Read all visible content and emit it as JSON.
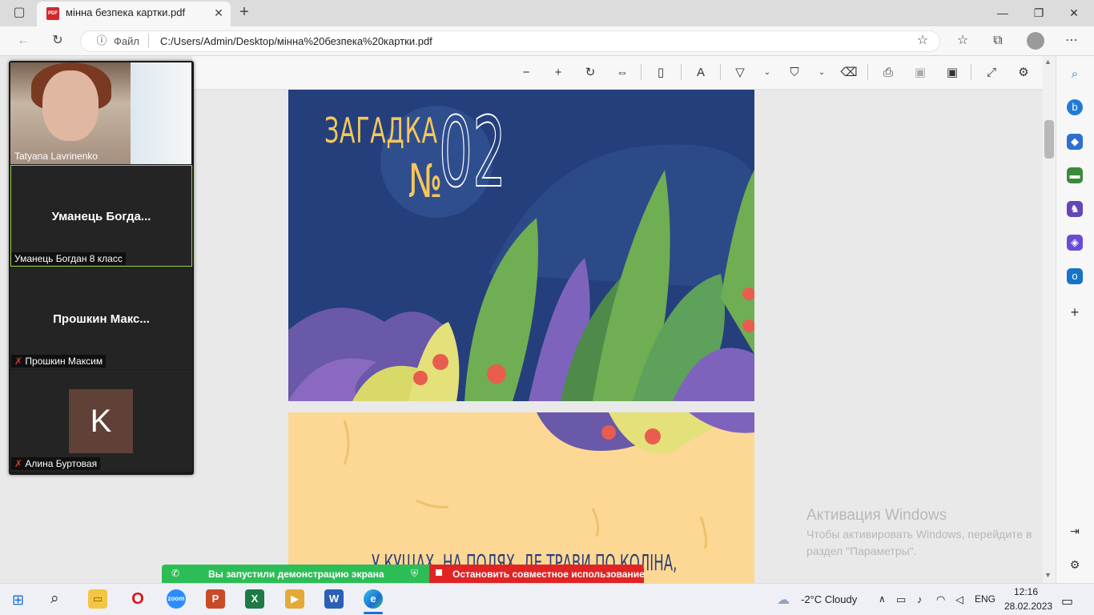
{
  "browser": {
    "tab_title": "мінна безпека картки.pdf",
    "tab_icon_text": "PDF",
    "address_label": "Файл",
    "url": "C:/Users/Admin/Desktop/мінна%20безпека%20картки.pdf"
  },
  "pdf": {
    "page1": {
      "word": "ЗАГАДКА",
      "no": "№",
      "number": "02"
    },
    "page2": {
      "text": "У КУЩАХ, НА ПОЛЯХ, ДЕ ТРАВИ ПО КОЛІНА,"
    }
  },
  "zoom": {
    "participants": [
      {
        "name": "Tatyana Lavrinenko",
        "video": true
      },
      {
        "name": "Уманець Богдан 8 класс",
        "short": "Уманець  Богда...",
        "muted": false
      },
      {
        "name": "Прошкин Максим",
        "short": "Прошкин  Макс...",
        "muted": true
      },
      {
        "name": "Алина Буртовая",
        "initial": "K",
        "muted": true
      }
    ],
    "share_message": "Вы запустили демонстрацию экрана",
    "stop_share": "Остановить совместное использование"
  },
  "watermark": {
    "title": "Активация Windows",
    "body": "Чтобы активировать Windows, перейдите в раздел \"Параметры\"."
  },
  "taskbar": {
    "weather": "-2°C  Cloudy",
    "lang": "ENG",
    "time": "12:16",
    "date": "28.02.2023"
  }
}
